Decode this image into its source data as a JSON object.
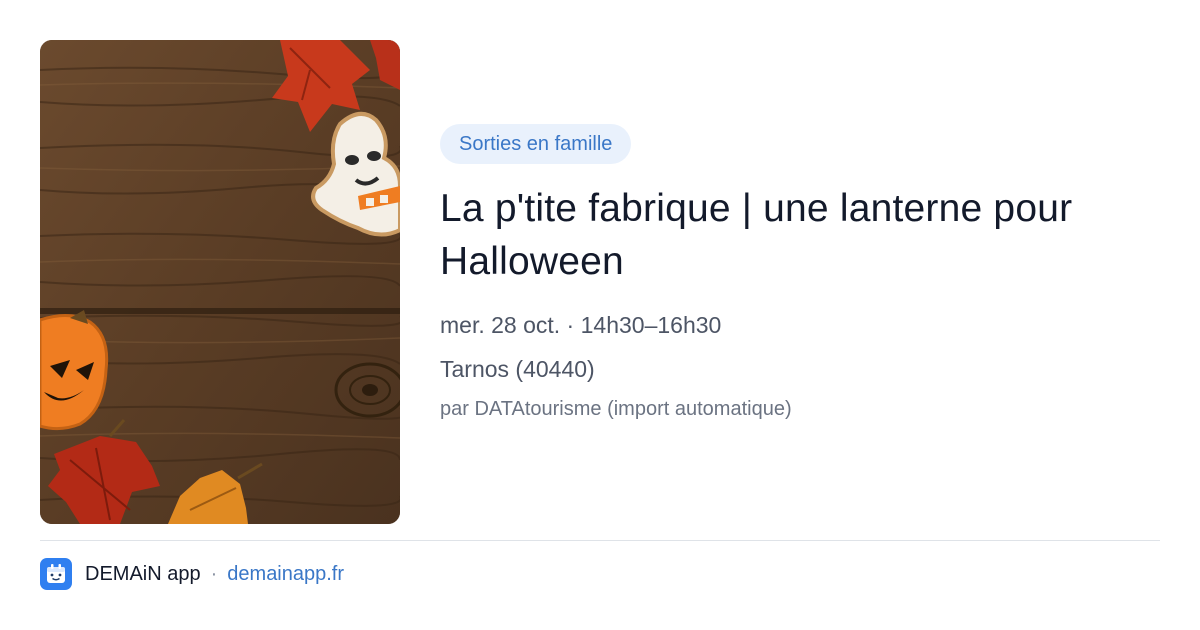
{
  "event": {
    "category": "Sorties en famille",
    "title": "La p'tite fabrique | une lanterne pour Halloween",
    "date": "mer. 28 oct. · 14h30–16h30",
    "location": "Tarnos (40440)",
    "source": "par DATAtourisme (import automatique)",
    "image": {
      "icon": "halloween-photo",
      "description": "Wooden background with autumn leaves, ghost and pumpkin cookies"
    }
  },
  "footer": {
    "app_icon": "app-logo-icon",
    "app_name": "DEMAiN app",
    "separator": "·",
    "app_url": "demainapp.fr"
  },
  "colors": {
    "accent": "#3a77c7",
    "category_bg": "#e9f1fc",
    "title": "#131a2b",
    "muted": "#4d5565",
    "app_icon_bg": "#2f7ff0"
  }
}
